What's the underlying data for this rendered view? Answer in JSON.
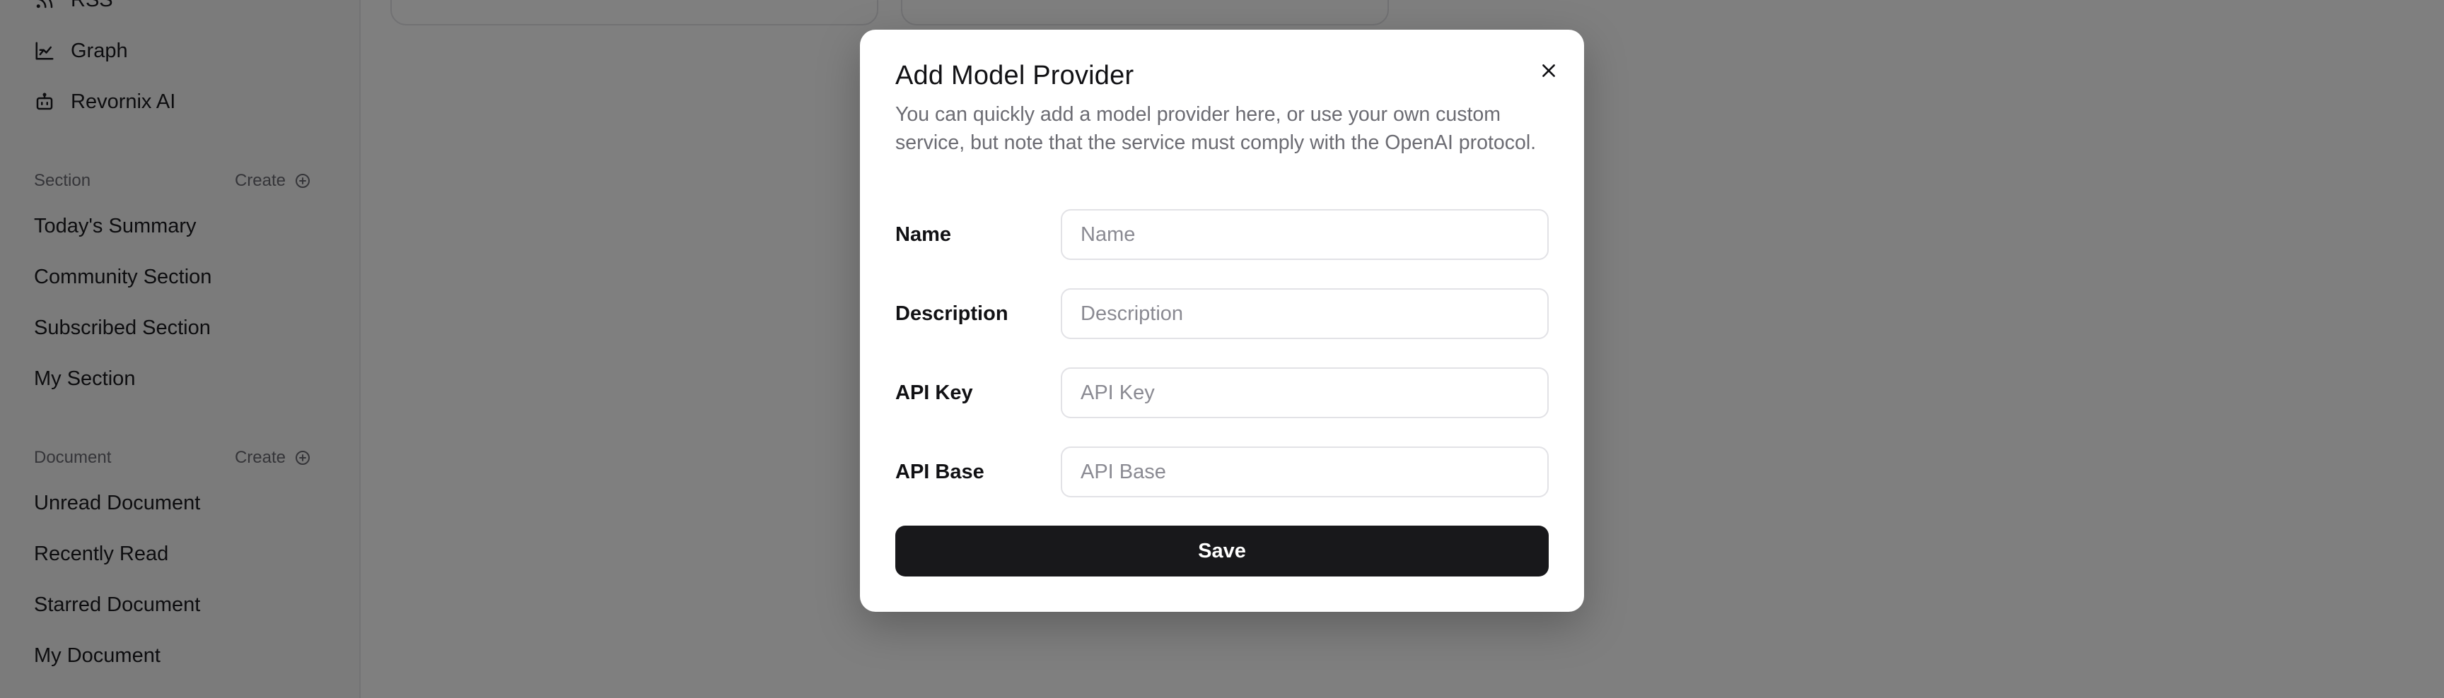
{
  "sidebar": {
    "nav": [
      {
        "label": "RSS",
        "icon": "rss-icon"
      },
      {
        "label": "Graph",
        "icon": "graph-icon"
      },
      {
        "label": "Revornix AI",
        "icon": "robot-icon"
      }
    ],
    "section": {
      "title": "Section",
      "create_label": "Create",
      "items": [
        "Today's Summary",
        "Community Section",
        "Subscribed Section",
        "My Section"
      ]
    },
    "document": {
      "title": "Document",
      "create_label": "Create",
      "items": [
        "Unread Document",
        "Recently Read",
        "Starred Document",
        "My Document"
      ]
    }
  },
  "modal": {
    "title": "Add Model Provider",
    "description": "You can quickly add a model provider here, or use your own custom service, but note that the service must comply with the OpenAI protocol.",
    "fields": [
      {
        "label": "Name",
        "placeholder": "Name",
        "value": ""
      },
      {
        "label": "Description",
        "placeholder": "Description",
        "value": ""
      },
      {
        "label": "API Key",
        "placeholder": "API Key",
        "value": ""
      },
      {
        "label": "API Base",
        "placeholder": "API Base",
        "value": ""
      }
    ],
    "save_label": "Save"
  },
  "colors": {
    "primary_button": "#18181b",
    "overlay": "rgba(0,0,0,0.5)",
    "sidebar_bg": "#f6f6f7"
  }
}
